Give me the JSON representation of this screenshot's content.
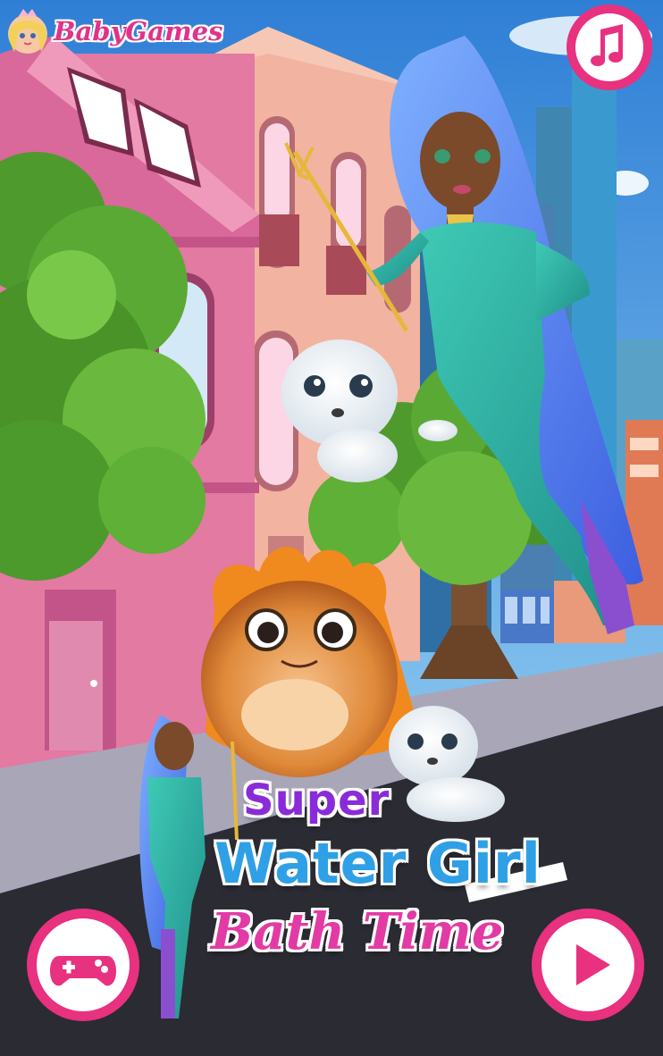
{
  "header": {
    "logo_text": "BabyGames"
  },
  "title": {
    "line1": "Super",
    "line2": "Water Girl",
    "line3": "Bath Time"
  },
  "controls": {
    "music_icon": "music-note-icon",
    "more_games_icon": "gamepad-icon",
    "play_icon": "play-icon"
  },
  "colors": {
    "button_ring": "#e8317f",
    "button_fill": "#ffffff",
    "play_triangle": "#e8317f",
    "sky": "#3a86d6",
    "road": "#2b2b33"
  }
}
